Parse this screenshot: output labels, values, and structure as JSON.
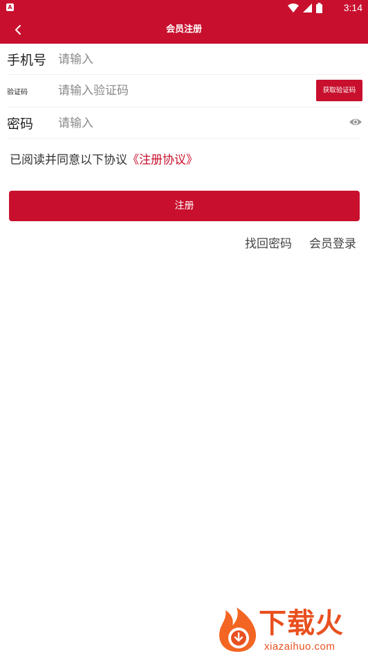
{
  "colors": {
    "brand": "#c8102e",
    "watermark": "#e9501f"
  },
  "status_bar": {
    "badge": "A",
    "time": "3:14",
    "icons": [
      "wifi-icon",
      "signal-icon",
      "battery-icon"
    ]
  },
  "header": {
    "title": "会员注册",
    "back_icon": "chevron-left-icon"
  },
  "form": {
    "phone": {
      "label": "手机号",
      "placeholder": "请输入",
      "value": ""
    },
    "code": {
      "label": "验证码",
      "placeholder": "请输入验证码",
      "value": "",
      "button": "获取验证码"
    },
    "password": {
      "label": "密码",
      "placeholder": "请输入",
      "value": "",
      "toggle_icon": "eye-icon"
    }
  },
  "agreement": {
    "text": "已阅读并同意以下协议",
    "link": "《注册协议》"
  },
  "register_button": "注册",
  "links": {
    "forgot": "找回密码",
    "login": "会员登录"
  },
  "watermark": {
    "text": "下载火",
    "url": "xiazaihuo.com"
  }
}
